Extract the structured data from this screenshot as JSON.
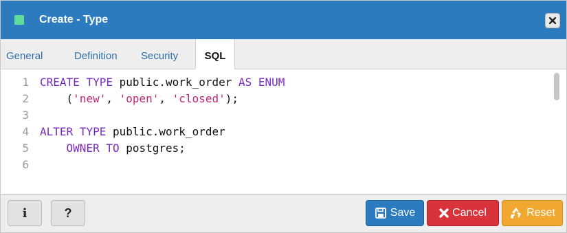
{
  "window": {
    "title": "Create - Type",
    "close_icon": "close-icon"
  },
  "tabs": [
    {
      "label": "General"
    },
    {
      "label": "Definition"
    },
    {
      "label": "Security"
    },
    {
      "label": "SQL",
      "active": true
    }
  ],
  "editor": {
    "line_numbers": [
      "1",
      "2",
      "3",
      "4",
      "5",
      "6"
    ],
    "lines": [
      "CREATE TYPE public.work_order AS ENUM",
      "    ('new', 'open', 'closed');",
      "",
      "ALTER TYPE public.work_order",
      "    OWNER TO postgres;",
      ""
    ]
  },
  "footer": {
    "info_label": "i",
    "help_label": "?",
    "save_label": "Save",
    "cancel_label": "Cancel",
    "reset_label": "Reset"
  },
  "colors": {
    "titlebar": "#2d7bbf",
    "save": "#2d7bbf",
    "cancel": "#d8333a",
    "reset": "#f0a830",
    "keyword": "#7a2bbf",
    "string": "#c0287a"
  }
}
